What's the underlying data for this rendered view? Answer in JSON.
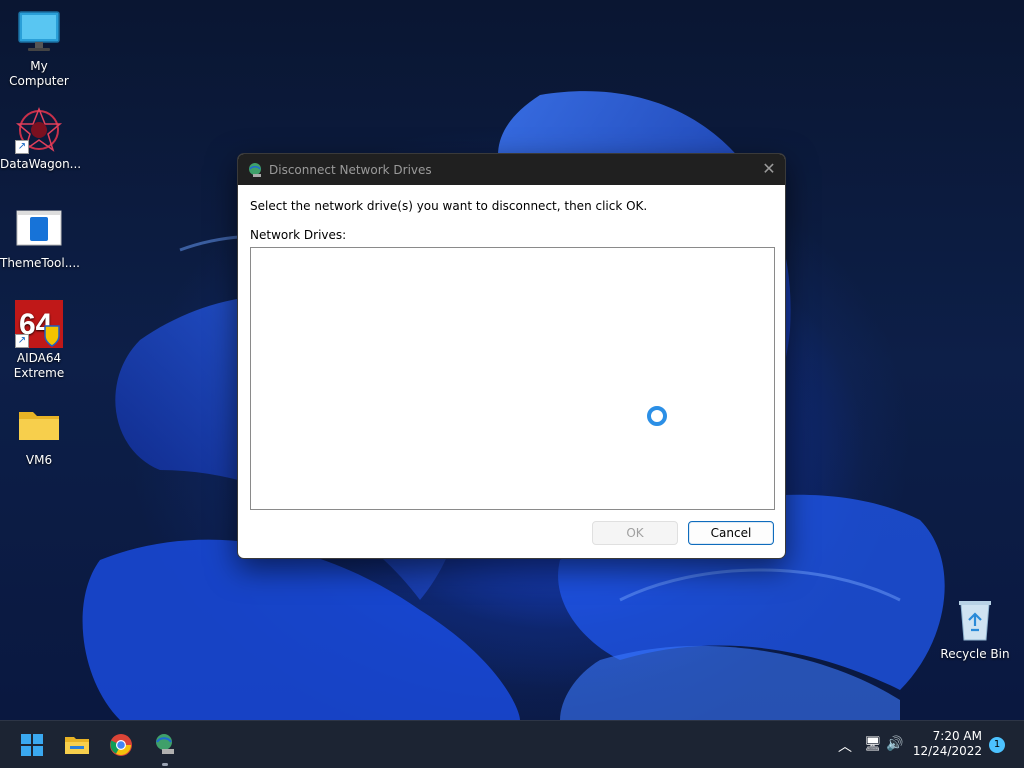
{
  "desktop": {
    "icons": [
      {
        "label": "My Computer",
        "icon": "monitor-icon"
      },
      {
        "label": "DataWagon...",
        "icon": "datawagon-icon"
      },
      {
        "label": "ThemeTool....",
        "icon": "themetool-icon"
      },
      {
        "label": "AIDA64\nExtreme",
        "icon": "aida64-icon"
      },
      {
        "label": "VM6",
        "icon": "folder-icon"
      },
      {
        "label": "Recycle Bin",
        "icon": "recycle-bin-icon"
      }
    ]
  },
  "dialog": {
    "title": "Disconnect Network Drives",
    "instruction": "Select the network drive(s) you want to disconnect, then click OK.",
    "list_label": "Network Drives:",
    "ok_label": "OK",
    "cancel_label": "Cancel",
    "close_glyph": "✕"
  },
  "taskbar": {
    "items": [
      "start-icon",
      "file-explorer-icon",
      "chrome-icon",
      "network-drive-icon"
    ],
    "tray": {
      "time": "7:20 AM",
      "date": "12/24/2022",
      "notification_count": "1"
    }
  },
  "colors": {
    "accent": "#0f6cbd",
    "spinner": "#2b8fe6",
    "titlebar": "#202020",
    "taskbar": "#1c2433"
  }
}
